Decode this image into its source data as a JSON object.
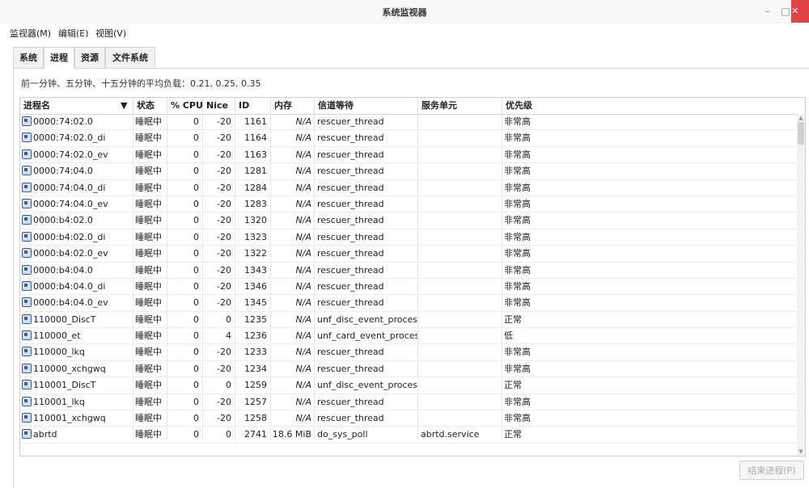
{
  "window": {
    "title": "系统监视器",
    "minimize": "–",
    "maximize": "□",
    "close": "✕"
  },
  "menubar": {
    "items": [
      "监视器(M)",
      "编辑(E)",
      "视图(V)"
    ]
  },
  "tabs": [
    "系统",
    "进程",
    "资源",
    "文件系统"
  ],
  "active_tab": "进程",
  "load_average": "前一分钟、五分钟、十五分钟的平均负载：0.21, 0.25, 0.35",
  "table": {
    "headers": {
      "name": "进程名",
      "sort_indicator": "▼",
      "state": "状态",
      "cpu": "% CPU",
      "nice": "Nice",
      "id": "ID",
      "mem": "内存",
      "wait": "信道等待",
      "unit": "服务单元",
      "prio": "优先级"
    },
    "rows": [
      {
        "name": "0000:74:02.0",
        "state": "睡眠中",
        "cpu": "0",
        "nice": "-20",
        "id": "1161",
        "mem": "N/A",
        "wait": "rescuer_thread",
        "unit": "",
        "prio": "非常高"
      },
      {
        "name": "0000:74:02.0_di",
        "state": "睡眠中",
        "cpu": "0",
        "nice": "-20",
        "id": "1164",
        "mem": "N/A",
        "wait": "rescuer_thread",
        "unit": "",
        "prio": "非常高"
      },
      {
        "name": "0000:74:02.0_ev",
        "state": "睡眠中",
        "cpu": "0",
        "nice": "-20",
        "id": "1163",
        "mem": "N/A",
        "wait": "rescuer_thread",
        "unit": "",
        "prio": "非常高"
      },
      {
        "name": "0000:74:04.0",
        "state": "睡眠中",
        "cpu": "0",
        "nice": "-20",
        "id": "1281",
        "mem": "N/A",
        "wait": "rescuer_thread",
        "unit": "",
        "prio": "非常高"
      },
      {
        "name": "0000:74:04.0_di",
        "state": "睡眠中",
        "cpu": "0",
        "nice": "-20",
        "id": "1284",
        "mem": "N/A",
        "wait": "rescuer_thread",
        "unit": "",
        "prio": "非常高"
      },
      {
        "name": "0000:74:04.0_ev",
        "state": "睡眠中",
        "cpu": "0",
        "nice": "-20",
        "id": "1283",
        "mem": "N/A",
        "wait": "rescuer_thread",
        "unit": "",
        "prio": "非常高"
      },
      {
        "name": "0000:b4:02.0",
        "state": "睡眠中",
        "cpu": "0",
        "nice": "-20",
        "id": "1320",
        "mem": "N/A",
        "wait": "rescuer_thread",
        "unit": "",
        "prio": "非常高"
      },
      {
        "name": "0000:b4:02.0_di",
        "state": "睡眠中",
        "cpu": "0",
        "nice": "-20",
        "id": "1323",
        "mem": "N/A",
        "wait": "rescuer_thread",
        "unit": "",
        "prio": "非常高"
      },
      {
        "name": "0000:b4:02.0_ev",
        "state": "睡眠中",
        "cpu": "0",
        "nice": "-20",
        "id": "1322",
        "mem": "N/A",
        "wait": "rescuer_thread",
        "unit": "",
        "prio": "非常高"
      },
      {
        "name": "0000:b4:04.0",
        "state": "睡眠中",
        "cpu": "0",
        "nice": "-20",
        "id": "1343",
        "mem": "N/A",
        "wait": "rescuer_thread",
        "unit": "",
        "prio": "非常高"
      },
      {
        "name": "0000:b4:04.0_di",
        "state": "睡眠中",
        "cpu": "0",
        "nice": "-20",
        "id": "1346",
        "mem": "N/A",
        "wait": "rescuer_thread",
        "unit": "",
        "prio": "非常高"
      },
      {
        "name": "0000:b4:04.0_ev",
        "state": "睡眠中",
        "cpu": "0",
        "nice": "-20",
        "id": "1345",
        "mem": "N/A",
        "wait": "rescuer_thread",
        "unit": "",
        "prio": "非常高"
      },
      {
        "name": "110000_DiscT",
        "state": "睡眠中",
        "cpu": "0",
        "nice": "0",
        "id": "1235",
        "mem": "N/A",
        "wait": "unf_disc_event_process",
        "unit": "",
        "prio": "正常"
      },
      {
        "name": "110000_et",
        "state": "睡眠中",
        "cpu": "0",
        "nice": "4",
        "id": "1236",
        "mem": "N/A",
        "wait": "unf_card_event_process",
        "unit": "",
        "prio": "低"
      },
      {
        "name": "110000_lkq",
        "state": "睡眠中",
        "cpu": "0",
        "nice": "-20",
        "id": "1233",
        "mem": "N/A",
        "wait": "rescuer_thread",
        "unit": "",
        "prio": "非常高"
      },
      {
        "name": "110000_xchgwq",
        "state": "睡眠中",
        "cpu": "0",
        "nice": "-20",
        "id": "1234",
        "mem": "N/A",
        "wait": "rescuer_thread",
        "unit": "",
        "prio": "非常高"
      },
      {
        "name": "110001_DiscT",
        "state": "睡眠中",
        "cpu": "0",
        "nice": "0",
        "id": "1259",
        "mem": "N/A",
        "wait": "unf_disc_event_process",
        "unit": "",
        "prio": "正常"
      },
      {
        "name": "110001_lkq",
        "state": "睡眠中",
        "cpu": "0",
        "nice": "-20",
        "id": "1257",
        "mem": "N/A",
        "wait": "rescuer_thread",
        "unit": "",
        "prio": "非常高"
      },
      {
        "name": "110001_xchgwq",
        "state": "睡眠中",
        "cpu": "0",
        "nice": "-20",
        "id": "1258",
        "mem": "N/A",
        "wait": "rescuer_thread",
        "unit": "",
        "prio": "非常高"
      },
      {
        "name": "abrtd",
        "state": "睡眠中",
        "cpu": "0",
        "nice": "0",
        "id": "2741",
        "mem": "18.6 MiB",
        "wait": "do_sys_poll",
        "unit": "abrtd.service",
        "prio": "正常"
      }
    ]
  },
  "end_process_button": "结束进程(P)",
  "colors": {
    "close_button": "#e04343",
    "border": "#d4d4d4",
    "disabled_text": "#aaaaaa"
  }
}
